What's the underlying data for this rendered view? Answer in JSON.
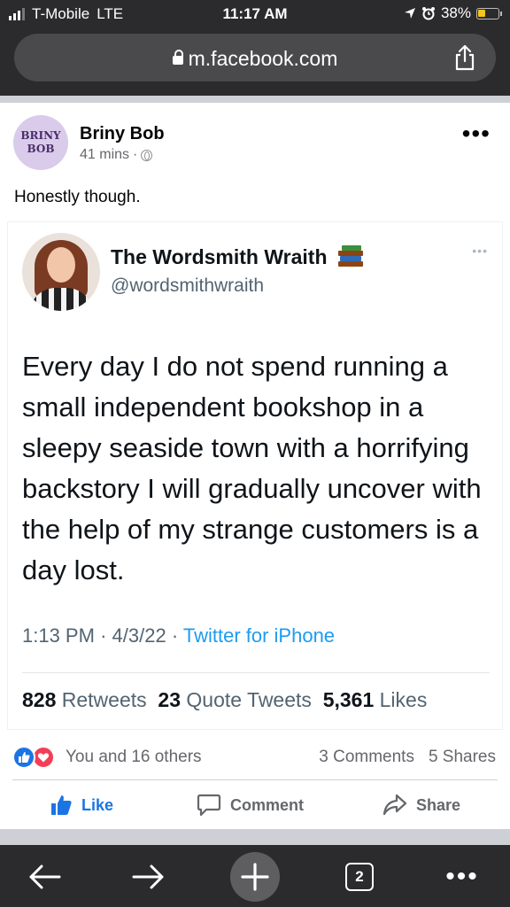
{
  "status_bar": {
    "carrier": "T-Mobile",
    "network": "LTE",
    "time": "11:17 AM",
    "battery": "38%",
    "battery_level": 0.38
  },
  "browser": {
    "url": "m.facebook.com",
    "tab_count": "2"
  },
  "post": {
    "avatar_text_line1": "BRINY",
    "avatar_text_line2": "BOB",
    "author": "Briny Bob",
    "time_ago": "41 mins",
    "separator": "·",
    "text": "Honestly though."
  },
  "tweet": {
    "name": "The Wordsmith Wraith",
    "handle": "@wordsmithwraith",
    "body": "Every day I do not spend running a small independent bookshop in a sleepy seaside town with a horrifying backstory I will gradually uncover with the help of my strange customers is a day lost.",
    "time": "1:13 PM",
    "date": "4/3/22",
    "dot": "·",
    "source": "Twitter for iPhone",
    "retweets_count": "828",
    "retweets_label": "Retweets",
    "quotes_count": "23",
    "quotes_label": "Quote Tweets",
    "likes_count": "5,361",
    "likes_label": "Likes"
  },
  "reactions": {
    "summary": "You and 16 others",
    "comments": "3 Comments",
    "shares": "5 Shares"
  },
  "actions": {
    "like": "Like",
    "comment": "Comment",
    "share": "Share"
  },
  "colors": {
    "facebook_blue": "#1b74e4",
    "love_red": "#f33e58",
    "twitter_blue": "#1d9bf0"
  },
  "icons": [
    "lock-icon",
    "share-icon",
    "globe-icon",
    "more-icon",
    "books-icon",
    "like-reaction-icon",
    "love-reaction-icon",
    "thumbs-up-icon",
    "comment-icon",
    "share-arrow-icon",
    "back-arrow-icon",
    "forward-arrow-icon",
    "plus-icon",
    "tabs-icon"
  ]
}
